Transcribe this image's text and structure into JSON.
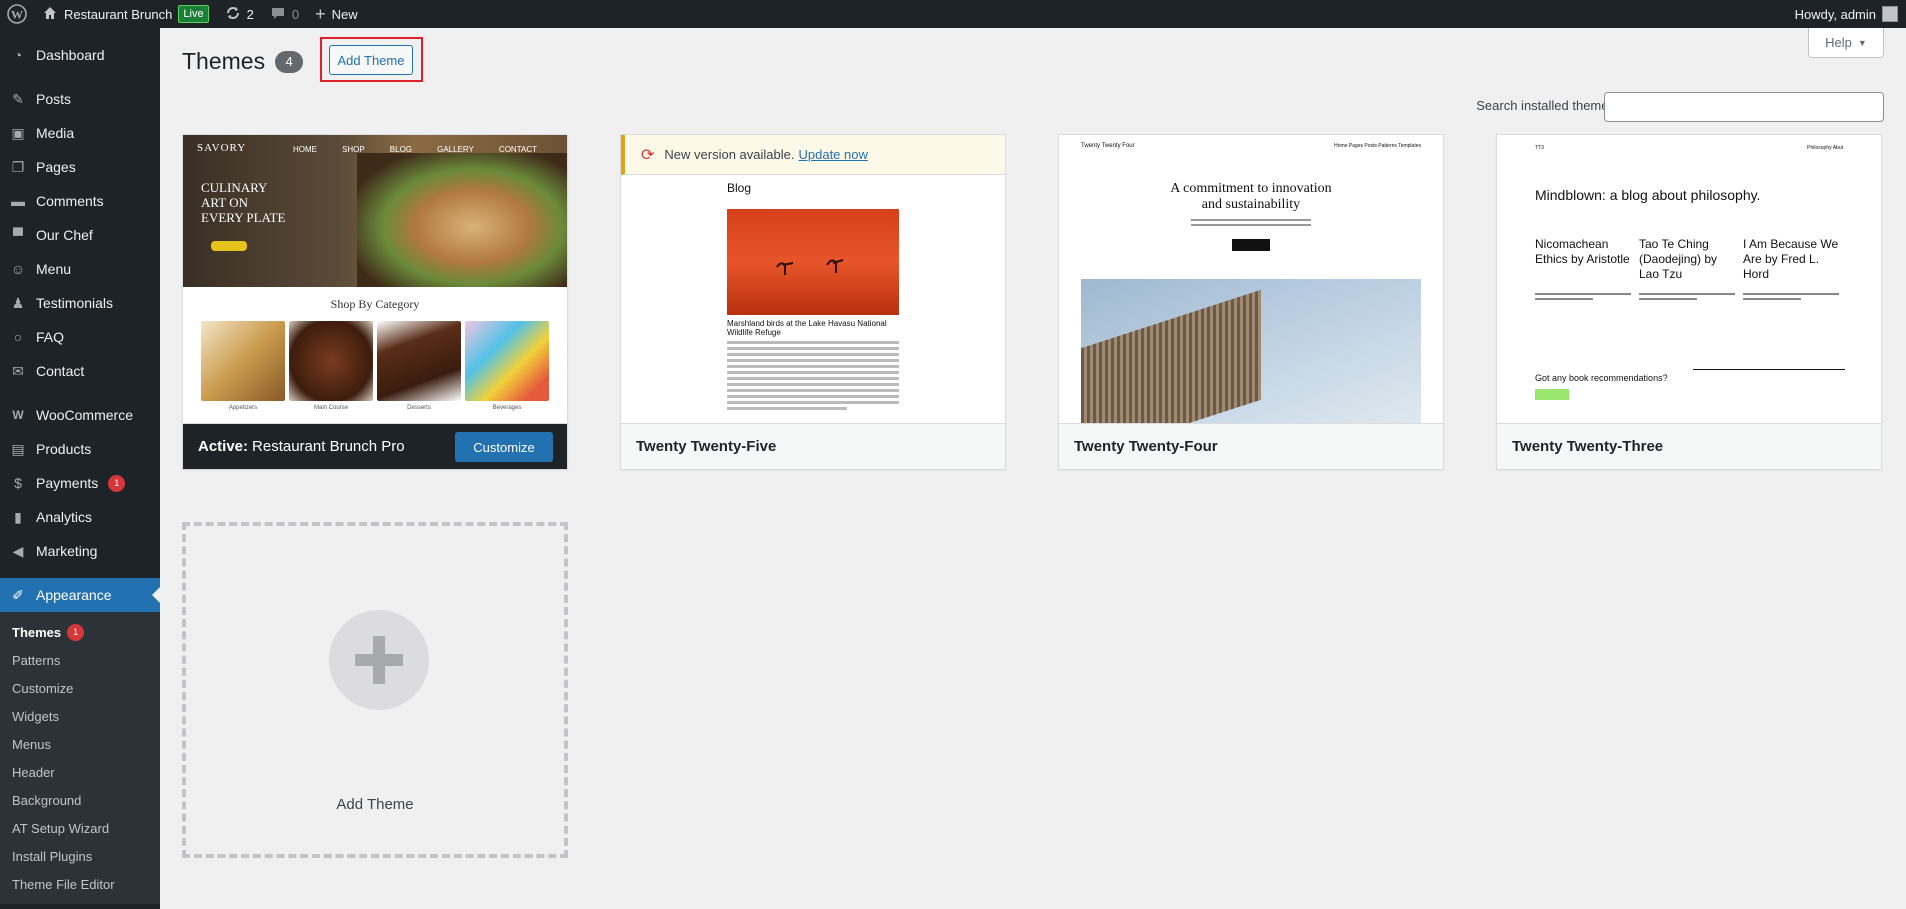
{
  "adminbar": {
    "site_name": "Restaurant Brunch",
    "live_label": "Live",
    "updates_count": "2",
    "comments_count": "0",
    "new_label": "New",
    "howdy": "Howdy, admin"
  },
  "sidebar": {
    "items": [
      {
        "label": "Dashboard",
        "icon": "dashboard-icon"
      },
      {
        "label": "Posts",
        "icon": "pin-icon"
      },
      {
        "label": "Media",
        "icon": "media-icon"
      },
      {
        "label": "Pages",
        "icon": "pages-icon"
      },
      {
        "label": "Comments",
        "icon": "comments-icon"
      },
      {
        "label": "Our Chef",
        "icon": "chef-icon"
      },
      {
        "label": "Menu",
        "icon": "smiley-icon"
      },
      {
        "label": "Testimonials",
        "icon": "person-icon"
      },
      {
        "label": "FAQ",
        "icon": "circle-icon"
      },
      {
        "label": "Contact",
        "icon": "mail-icon"
      },
      {
        "label": "WooCommerce",
        "icon": "woo-icon"
      },
      {
        "label": "Products",
        "icon": "archive-icon"
      },
      {
        "label": "Payments",
        "icon": "dollar-icon",
        "badge": "1"
      },
      {
        "label": "Analytics",
        "icon": "bar-chart-icon"
      },
      {
        "label": "Marketing",
        "icon": "megaphone-icon"
      },
      {
        "label": "Appearance",
        "icon": "paintbrush-icon"
      }
    ],
    "submenu": [
      {
        "label": "Themes",
        "badge": "1"
      },
      {
        "label": "Patterns"
      },
      {
        "label": "Customize"
      },
      {
        "label": "Widgets"
      },
      {
        "label": "Menus"
      },
      {
        "label": "Header"
      },
      {
        "label": "Background"
      },
      {
        "label": "AT Setup Wizard"
      },
      {
        "label": "Install Plugins"
      },
      {
        "label": "Theme File Editor"
      }
    ]
  },
  "header": {
    "title": "Themes",
    "count": "4",
    "add_theme": "Add Theme",
    "help": "Help",
    "search_label": "Search installed themes",
    "search_value": ""
  },
  "themes": [
    {
      "active_prefix": "Active:",
      "name": "Restaurant Brunch Pro",
      "customize": "Customize",
      "preview": {
        "logo": "SAVORY",
        "nav": [
          "HOME",
          "SHOP",
          "BLOG",
          "GALLERY",
          "CONTACT"
        ],
        "headline": [
          "CULINARY",
          "ART ON",
          "EVERY PLATE"
        ],
        "section": "Shop By Category",
        "categories": [
          "Appetizers",
          "Main Course",
          "Desserts",
          "Beverages"
        ]
      }
    },
    {
      "name": "Twenty Twenty-Five",
      "notice_text": "New version available.",
      "notice_link": "Update now",
      "preview": {
        "heading": "Blog",
        "caption": "Marshland birds at the Lake Havasu National Wildlife Refuge"
      }
    },
    {
      "name": "Twenty Twenty-Four",
      "preview": {
        "site": "Twenty Twenty Four",
        "nav": "Home  Pages  Posts  Patterns  Templates",
        "headline": [
          "A commitment to innovation",
          "and sustainability"
        ]
      }
    },
    {
      "name": "Twenty Twenty-Three",
      "preview": {
        "site": "TT3",
        "nav": "Philosophy   Abut",
        "headline": "Mindblown: a blog about philosophy.",
        "posts": [
          "Nicomachean Ethics by Aristotle",
          "Tao Te Ching (Daodejing) by Lao Tzu",
          "I Am Because We Are by Fred L. Hord"
        ],
        "ask": "Got any book recommendations?"
      }
    }
  ],
  "add_card": {
    "label": "Add Theme"
  },
  "colors": {
    "admin_dark": "#1d2327",
    "accent": "#2271b1",
    "badge_red": "#d63638",
    "highlight": "#e0202a"
  }
}
